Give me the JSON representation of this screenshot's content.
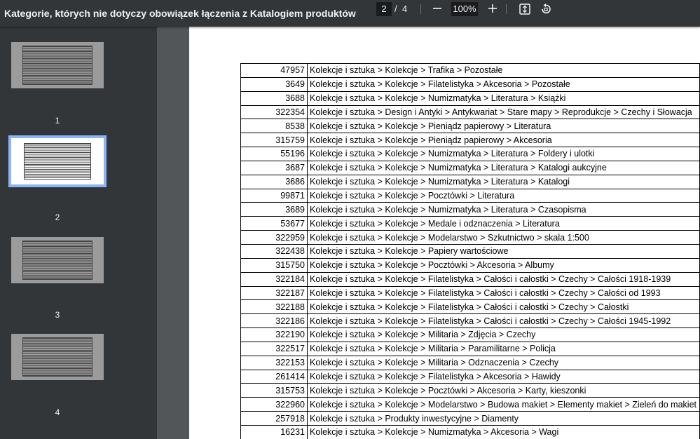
{
  "toolbar": {
    "title": "Kategorie, których nie dotyczy obowiązek łączenia z Katalogiem produktów",
    "current_page": "2",
    "page_separator": "/",
    "total_pages": "4",
    "zoom": "100%",
    "icons": [
      "zoom-out-icon",
      "zoom-in-icon",
      "fit-page-icon",
      "rotate-icon"
    ]
  },
  "sidebar": {
    "thumbnails": [
      {
        "label": "1",
        "active": false
      },
      {
        "label": "2",
        "active": true
      },
      {
        "label": "3",
        "active": false
      },
      {
        "label": "4",
        "active": false
      }
    ],
    "active_color": "#8ab4f8"
  },
  "table": {
    "rows": [
      {
        "id": "47957",
        "path": "Kolekcje i sztuka > Kolekcje > Trafika > Pozostałe"
      },
      {
        "id": "3649",
        "path": "Kolekcje i sztuka > Kolekcje > Filatelistyka > Akcesoria > Pozostałe"
      },
      {
        "id": "3688",
        "path": "Kolekcje i sztuka > Kolekcje > Numizmatyka > Literatura > Książki"
      },
      {
        "id": "322354",
        "path": "Kolekcje i sztuka > Design i Antyki > Antykwariat > Stare mapy > Reprodukcje > Czechy i Słowacja"
      },
      {
        "id": "8538",
        "path": "Kolekcje i sztuka > Kolekcje > Pieniądz papierowy > Literatura"
      },
      {
        "id": "315759",
        "path": "Kolekcje i sztuka > Kolekcje > Pieniądz papierowy > Akcesoria"
      },
      {
        "id": "55196",
        "path": "Kolekcje i sztuka > Kolekcje > Numizmatyka > Literatura > Foldery i ulotki"
      },
      {
        "id": "3687",
        "path": "Kolekcje i sztuka > Kolekcje > Numizmatyka > Literatura > Katalogi aukcyjne"
      },
      {
        "id": "3686",
        "path": "Kolekcje i sztuka > Kolekcje > Numizmatyka > Literatura > Katalogi"
      },
      {
        "id": "99871",
        "path": "Kolekcje i sztuka > Kolekcje > Pocztówki > Literatura"
      },
      {
        "id": "3689",
        "path": "Kolekcje i sztuka > Kolekcje > Numizmatyka > Literatura > Czasopisma"
      },
      {
        "id": "53677",
        "path": "Kolekcje i sztuka > Kolekcje > Medale i odznaczenia > Literatura"
      },
      {
        "id": "322959",
        "path": "Kolekcje i sztuka > Kolekcje > Modelarstwo > Szkutnictwo > skala 1:500"
      },
      {
        "id": "322438",
        "path": "Kolekcje i sztuka > Kolekcje > Papiery wartościowe"
      },
      {
        "id": "315750",
        "path": "Kolekcje i sztuka > Kolekcje > Pocztówki > Akcesoria > Albumy"
      },
      {
        "id": "322184",
        "path": "Kolekcje i sztuka > Kolekcje > Filatelistyka > Całości i całostki > Czechy > Całości 1918-1939"
      },
      {
        "id": "322187",
        "path": "Kolekcje i sztuka > Kolekcje > Filatelistyka > Całości i całostki > Czechy > Całości od 1993"
      },
      {
        "id": "322188",
        "path": "Kolekcje i sztuka > Kolekcje > Filatelistyka > Całości i całostki > Czechy > Całostki"
      },
      {
        "id": "322186",
        "path": "Kolekcje i sztuka > Kolekcje > Filatelistyka > Całości i całostki > Czechy > Całości 1945-1992"
      },
      {
        "id": "322190",
        "path": "Kolekcje i sztuka > Kolekcje > Militaria > Zdjęcia > Czechy"
      },
      {
        "id": "322517",
        "path": "Kolekcje i sztuka > Kolekcje > Militaria > Paramilitarne > Policja"
      },
      {
        "id": "322153",
        "path": "Kolekcje i sztuka > Kolekcje > Militaria > Odznaczenia > Czechy"
      },
      {
        "id": "261414",
        "path": "Kolekcje i sztuka > Kolekcje > Filatelistyka > Akcesoria > Hawidy"
      },
      {
        "id": "315753",
        "path": "Kolekcje i sztuka > Kolekcje > Pocztówki > Akcesoria > Karty, kieszonki"
      },
      {
        "id": "322960",
        "path": "Kolekcje i sztuka > Kolekcje > Modelarstwo > Budowa makiet > Elementy makiet > Zieleń do makiet"
      },
      {
        "id": "257918",
        "path": "Kolekcje i sztuka > Produkty inwestycyjne > Diamenty"
      },
      {
        "id": "16231",
        "path": "Kolekcje i sztuka > Kolekcje > Numizmatyka > Akcesoria > Wagi"
      }
    ]
  }
}
